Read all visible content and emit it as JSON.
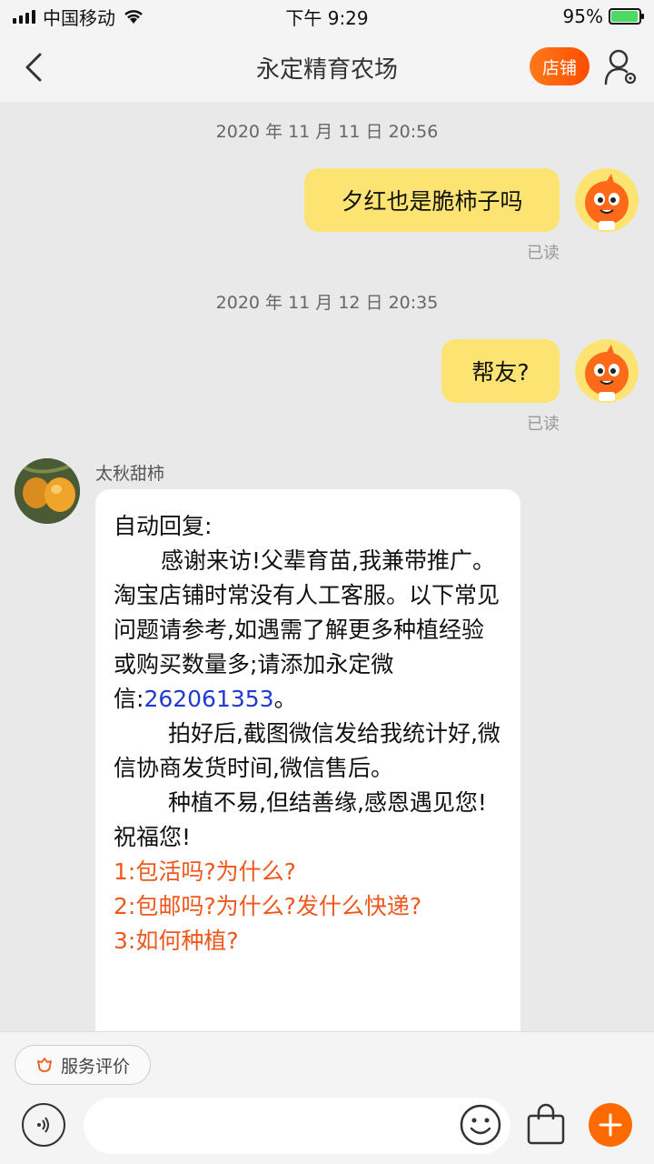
{
  "status_bar": {
    "carrier": "中国移动",
    "time": "下午 9:29",
    "battery": "95%",
    "battery_level": 0.95
  },
  "header": {
    "title": "永定精育农场",
    "shop_button": "店铺"
  },
  "messages": [
    {
      "timestamp": "2020 年 11 月 11 日 20:56",
      "text": "夕红也是脆柿子吗",
      "status": "已读"
    },
    {
      "timestamp": "2020 年 11 月 12 日 20:35",
      "text": "帮友?",
      "status": "已读"
    }
  ],
  "reply": {
    "sender": "太秋甜柿",
    "line_title": "自动回复:",
    "para1": "感谢来访!父辈育苗,我兼带推广。淘宝店铺时常没有人工客服。以下常见问题请参考,如遇需了解更多种植经验或购买数量多;请添加永定微信:",
    "wechat_id": "262061353",
    "para1_end": "。",
    "para2": "拍好后,截图微信发给我统计好,微信协商发货时间,微信售后。",
    "para3": "种植不易,但结善缘,感恩遇见您!祝福您!",
    "faq": [
      "1:包活吗?为什么?",
      "2:包邮吗?为什么?发什么快递?",
      "3:如何种植?"
    ]
  },
  "bottom": {
    "rate_label": "服务评价",
    "input_placeholder": ""
  }
}
